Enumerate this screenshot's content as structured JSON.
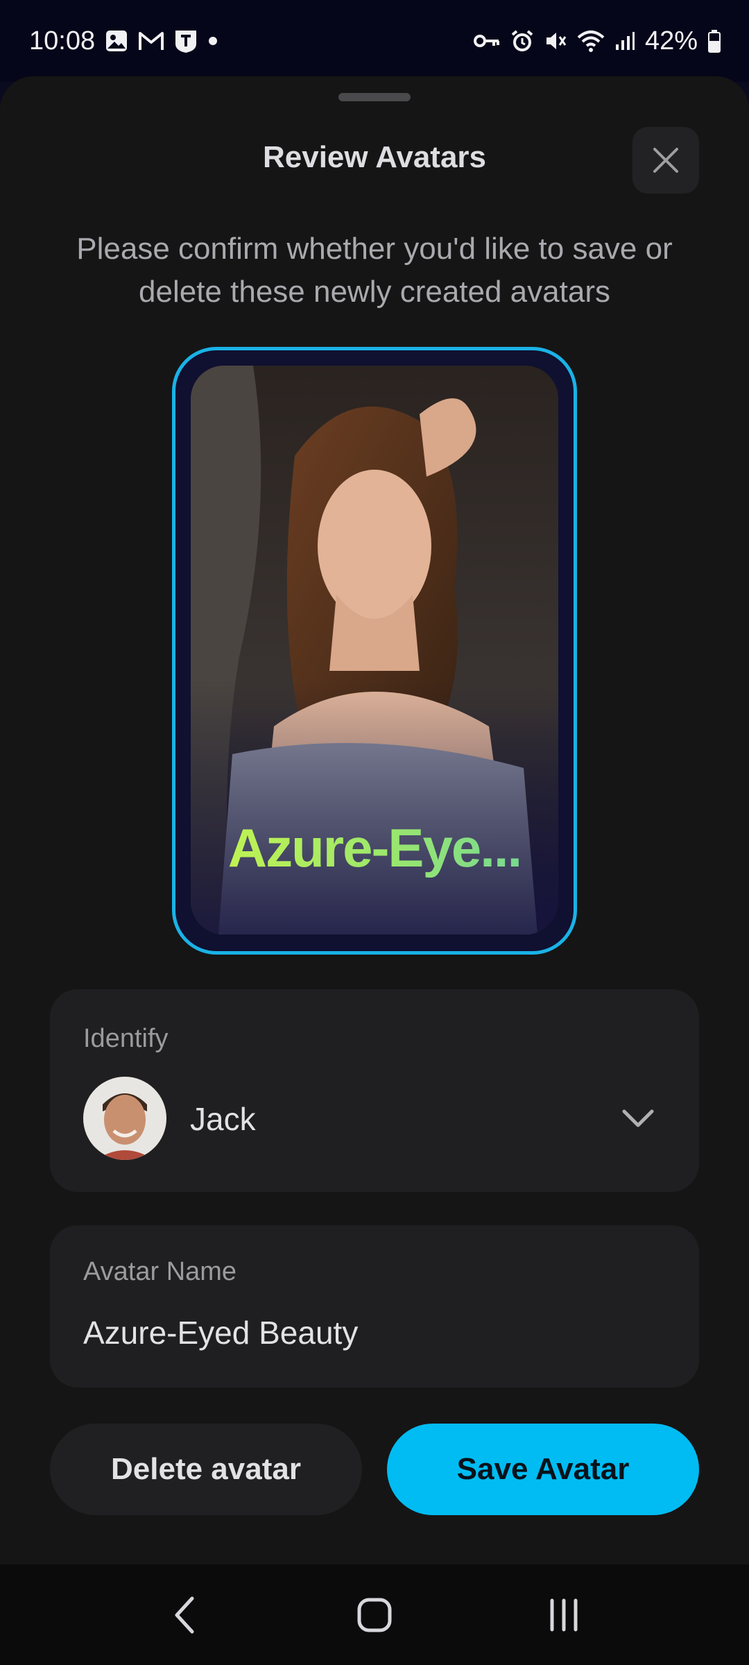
{
  "status_bar": {
    "time": "10:08",
    "battery": "42%",
    "left_icons": [
      "image-icon",
      "gmail-icon",
      "t-app-icon",
      "dot-icon"
    ],
    "right_icons": [
      "vpn-key-icon",
      "alarm-icon",
      "mute-icon",
      "wifi-icon",
      "signal-icon",
      "battery-icon"
    ]
  },
  "sheet": {
    "title": "Review Avatars",
    "subtitle": "Please confirm whether you'd like to save or delete these newly created avatars",
    "avatar_overlay_name": "Azure-Eye...",
    "identify": {
      "label": "Identify",
      "selected_name": "Jack"
    },
    "avatar_name": {
      "label": "Avatar Name",
      "value": "Azure-Eyed Beauty"
    },
    "buttons": {
      "delete_label": "Delete avatar",
      "save_label": "Save Avatar"
    }
  },
  "colors": {
    "accent": "#00bcf2",
    "frame_border": "#1ab2e6",
    "sheet_bg": "#151515",
    "card_bg": "#1f1f21"
  }
}
